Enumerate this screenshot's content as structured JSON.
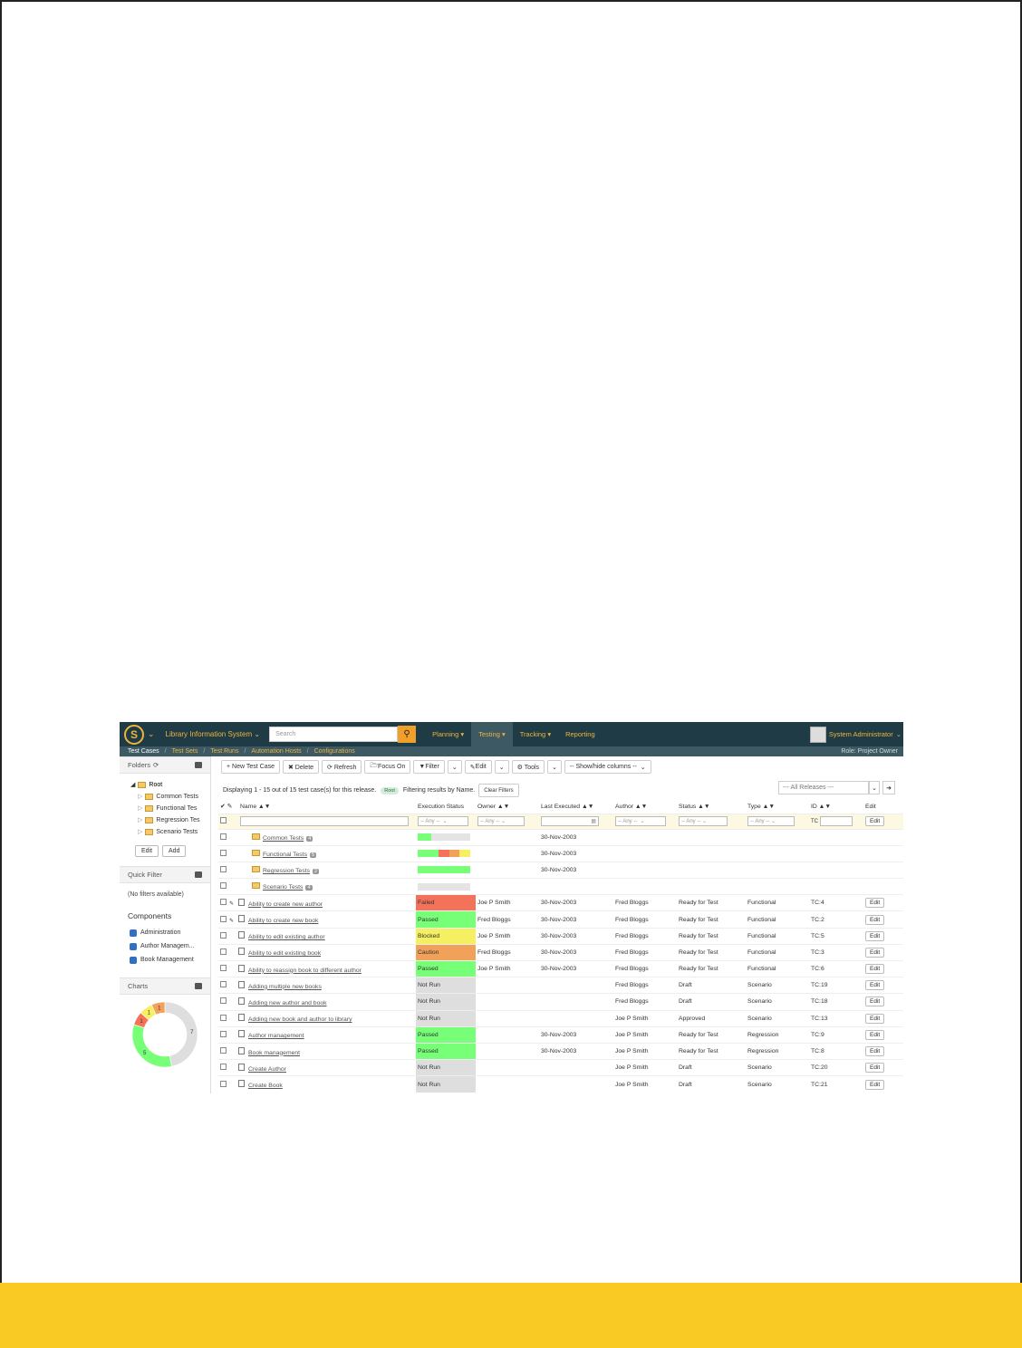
{
  "header": {
    "project": "Library Information System",
    "search_placeholder": "Search",
    "nav": [
      "Planning ▾",
      "Testing ▾",
      "Tracking ▾",
      "Reporting"
    ],
    "active_nav": 1,
    "user": "System Administrator"
  },
  "subnav": {
    "items": [
      "Test Cases",
      "Test Sets",
      "Test Runs",
      "Automation Hosts",
      "Configurations"
    ],
    "role": "Role: Project Owner"
  },
  "sidebar": {
    "folders_title": "Folders",
    "root": "Root",
    "folders": [
      "Common Tests",
      "Functional Tes",
      "Regression Tes",
      "Scenario Tests"
    ],
    "edit_label": "Edit",
    "add_label": "Add",
    "quick_filter_title": "Quick Filter",
    "no_filters": "(No filters available)",
    "components_title": "Components",
    "components": [
      "Administration",
      "Author Managem...",
      "Book Management"
    ],
    "charts_title": "Charts"
  },
  "chart_data": {
    "type": "pie",
    "categories": [
      "Not Run",
      "Passed",
      "Failed",
      "Blocked",
      "Caution"
    ],
    "values": [
      7,
      5,
      1,
      1,
      1
    ],
    "colors": [
      "#dedede",
      "#77ff77",
      "#f4725a",
      "#f5f062",
      "#f1a15a"
    ]
  },
  "toolbar": {
    "new": "+ New Test Case",
    "delete": "✖ Delete",
    "refresh": "⟳ Refresh",
    "focus": "Focus On",
    "filter": "Filter",
    "edit": "Edit",
    "tools": "⚙ Tools",
    "columns": "-- Show/hide columns --",
    "release": "--- All Releases ---"
  },
  "info": {
    "displaying": "Displaying 1 - 15 out of 15 test case(s) for this release.",
    "filtering": "Filtering results by Name.",
    "pill": "Root",
    "clear": "Clear Filters"
  },
  "columns": {
    "name": "Name ▲▼",
    "status": "Execution Status",
    "owner": "Owner ▲▼",
    "last": "Last Executed ▲▼",
    "author": "Author ▲▼",
    "wstatus": "Status ▲▼",
    "type": "Type ▲▼",
    "id": "ID ▲▼",
    "edit": "Edit"
  },
  "filters": {
    "any": "-- Any --",
    "tc": "TC",
    "edit": "Edit"
  },
  "folder_rows": [
    {
      "name": "Common Tests",
      "count": "4",
      "last": "30-Nov-2003",
      "bar": [
        [
          0.25,
          "#77ff77"
        ],
        [
          0.75,
          "#e4e4e4"
        ]
      ]
    },
    {
      "name": "Functional Tests",
      "count": "5",
      "last": "30-Nov-2003",
      "bar": [
        [
          0.4,
          "#77ff77"
        ],
        [
          0.2,
          "#f4725a"
        ],
        [
          0.2,
          "#f1a15a"
        ],
        [
          0.2,
          "#f5f062"
        ]
      ]
    },
    {
      "name": "Regression Tests",
      "count": "2",
      "last": "30-Nov-2003",
      "bar": [
        [
          1.0,
          "#77ff77"
        ]
      ]
    },
    {
      "name": "Scenario Tests",
      "count": "4",
      "last": "",
      "bar": [
        [
          1.0,
          "#e4e4e4"
        ]
      ]
    }
  ],
  "rows": [
    {
      "name": "Ability to create new author",
      "status": "Failed",
      "owner": "Joe P Smith",
      "last": "30-Nov-2003",
      "author": "Fred Bloggs",
      "wstatus": "Ready for Test",
      "type": "Functional",
      "id": "TC:4",
      "clip": true
    },
    {
      "name": "Ability to create new book",
      "status": "Passed",
      "owner": "Fred Bloggs",
      "last": "30-Nov-2003",
      "author": "Fred Bloggs",
      "wstatus": "Ready for Test",
      "type": "Functional",
      "id": "TC:2",
      "clip": true
    },
    {
      "name": "Ability to edit existing author",
      "status": "Blocked",
      "owner": "Joe P Smith",
      "last": "30-Nov-2003",
      "author": "Fred Bloggs",
      "wstatus": "Ready for Test",
      "type": "Functional",
      "id": "TC:5",
      "clip": false
    },
    {
      "name": "Ability to edit existing book",
      "status": "Caution",
      "owner": "Fred Bloggs",
      "last": "30-Nov-2003",
      "author": "Fred Bloggs",
      "wstatus": "Ready for Test",
      "type": "Functional",
      "id": "TC:3",
      "clip": false
    },
    {
      "name": "Ability to reassign book to different author",
      "status": "Passed",
      "owner": "Joe P Smith",
      "last": "30-Nov-2003",
      "author": "Fred Bloggs",
      "wstatus": "Ready for Test",
      "type": "Functional",
      "id": "TC:6",
      "clip": false
    },
    {
      "name": "Adding multiple new books",
      "status": "Not Run",
      "owner": "",
      "last": "",
      "author": "Fred Bloggs",
      "wstatus": "Draft",
      "type": "Scenario",
      "id": "TC:19",
      "clip": false
    },
    {
      "name": "Adding new author and book",
      "status": "Not Run",
      "owner": "",
      "last": "",
      "author": "Fred Bloggs",
      "wstatus": "Draft",
      "type": "Scenario",
      "id": "TC:18",
      "clip": false
    },
    {
      "name": "Adding new book and author to library",
      "status": "Not Run",
      "owner": "",
      "last": "",
      "author": "Joe P Smith",
      "wstatus": "Approved",
      "type": "Scenario",
      "id": "TC:13",
      "clip": false
    },
    {
      "name": "Author management",
      "status": "Passed",
      "owner": "",
      "last": "30-Nov-2003",
      "author": "Joe P Smith",
      "wstatus": "Ready for Test",
      "type": "Regression",
      "id": "TC:9",
      "clip": false
    },
    {
      "name": "Book management",
      "status": "Passed",
      "owner": "",
      "last": "30-Nov-2003",
      "author": "Joe P Smith",
      "wstatus": "Ready for Test",
      "type": "Regression",
      "id": "TC:8",
      "clip": false
    },
    {
      "name": "Create Author",
      "status": "Not Run",
      "owner": "",
      "last": "",
      "author": "Joe P Smith",
      "wstatus": "Draft",
      "type": "Scenario",
      "id": "TC:20",
      "clip": false
    },
    {
      "name": "Create Book",
      "status": "Not Run",
      "owner": "",
      "last": "",
      "author": "Joe P Smith",
      "wstatus": "Draft",
      "type": "Scenario",
      "id": "TC:21",
      "clip": false
    }
  ],
  "edit_label": "Edit"
}
